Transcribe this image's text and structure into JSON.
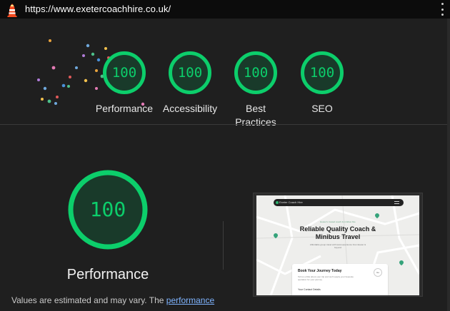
{
  "browser": {
    "url": "https://www.exetercoachhire.co.uk/",
    "logo_icon": "lighthouse-icon",
    "menu_icon": "kebab-menu-icon"
  },
  "colors": {
    "pass": "#0cce6b",
    "background": "#1f1f1f",
    "link": "#7fb4ff"
  },
  "gauges": [
    {
      "score": "100",
      "label": "Performance"
    },
    {
      "score": "100",
      "label": "Accessibility"
    },
    {
      "score": "100",
      "label": "Best Practices"
    },
    {
      "score": "100",
      "label": "SEO"
    }
  ],
  "performance": {
    "score": "100",
    "title": "Performance",
    "description_prefix": "Values are estimated and may vary. The ",
    "description_link": "performance"
  },
  "screenshot": {
    "brand": "Exeter Coach Hire",
    "headline": "Reliable Quality Coach & Minibus Travel",
    "subtitle": "Affordable group travel with local experience from Exeter & beyond",
    "eyebrow": "Exeter's trusted coach & minibus hire",
    "card_title": "Book Your Journey Today",
    "card_text": "Tell us a little about your trip and we'll supply your bespoke quotation for your journey",
    "card_label": "Your Contact Details",
    "card_button": "Go"
  }
}
